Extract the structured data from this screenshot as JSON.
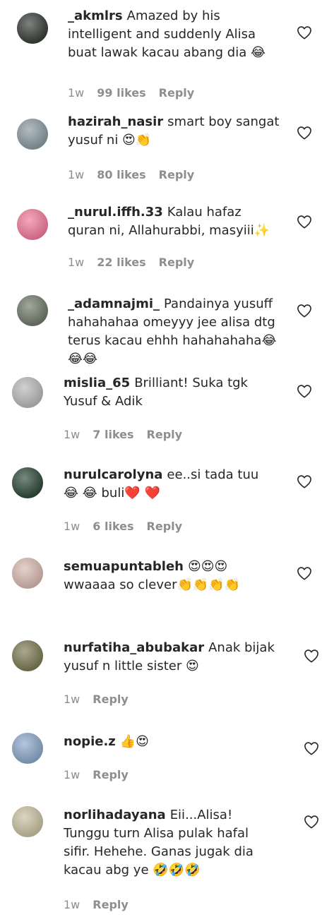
{
  "comments": [
    {
      "username": "_akmlrs",
      "text": "Amazed by his intelligent and suddenly Alisa buat lawak kacau abang dia 😂",
      "time": "1w",
      "likes": "99 likes",
      "reply": "Reply",
      "avatar_color": "#3a3f3a"
    },
    {
      "username": "hazirah_nasir",
      "text": "smart boy sangat yusuf ni 😍👏",
      "time": "1w",
      "likes": "80 likes",
      "reply": "Reply",
      "avatar_color": "#8a9aa0"
    },
    {
      "username": "_nurul.iffh.33",
      "text": "Kalau hafaz quran ni, Allahurabbi, masyiii✨",
      "time": "1w",
      "likes": "22 likes",
      "reply": "Reply",
      "avatar_color": "#f07a9a"
    },
    {
      "username": "_adamnajmi_",
      "text": "Pandainya yusuff hahahahaa omeyyy jee alisa dtg terus kacau ehhh hahahahaha😂 😂😂",
      "time": "",
      "likes": "",
      "reply": "",
      "avatar_color": "#6f7a6a"
    },
    {
      "username": "mislia_65",
      "text": "Brilliant! Suka tgk Yusuf & Adik",
      "time": "1w",
      "likes": "7 likes",
      "reply": "Reply",
      "avatar_color": "#b8b8b8"
    },
    {
      "username": "nurulcarolyna",
      "text": "ee..si tada tuu 😂 😂 buli❤️ ❤️",
      "time": "1w",
      "likes": "6 likes",
      "reply": "Reply",
      "avatar_color": "#2f4a3a"
    },
    {
      "username": "semuapuntableh",
      "text": "😍😍😍 wwaaaa so clever👏👏👏👏",
      "time": "",
      "likes": "",
      "reply": "",
      "avatar_color": "#d7b8b0"
    },
    {
      "username": "nurfatiha_abubakar",
      "text": "Anak bijak yusuf n little sister 😍",
      "time": "1w",
      "likes": "",
      "reply": "Reply",
      "avatar_color": "#7c7a55"
    },
    {
      "username": "nopie.z",
      "text": "👍😍",
      "time": "1w",
      "likes": "",
      "reply": "Reply",
      "avatar_color": "#8aa7c9"
    },
    {
      "username": "norlihadayana",
      "text": "Eii...Alisa! Tunggu turn Alisa pulak hafal sifir. Hehehe. Ganas jugak dia kacau abg ye 🤣🤣🤣",
      "time": "1w",
      "likes": "",
      "reply": "Reply",
      "avatar_color": "#c8c0a0"
    }
  ],
  "colors": {
    "text": "#262626",
    "muted": "#8e8e8e",
    "background": "#ffffff"
  },
  "icons": {
    "like": "heart-outline-icon"
  }
}
